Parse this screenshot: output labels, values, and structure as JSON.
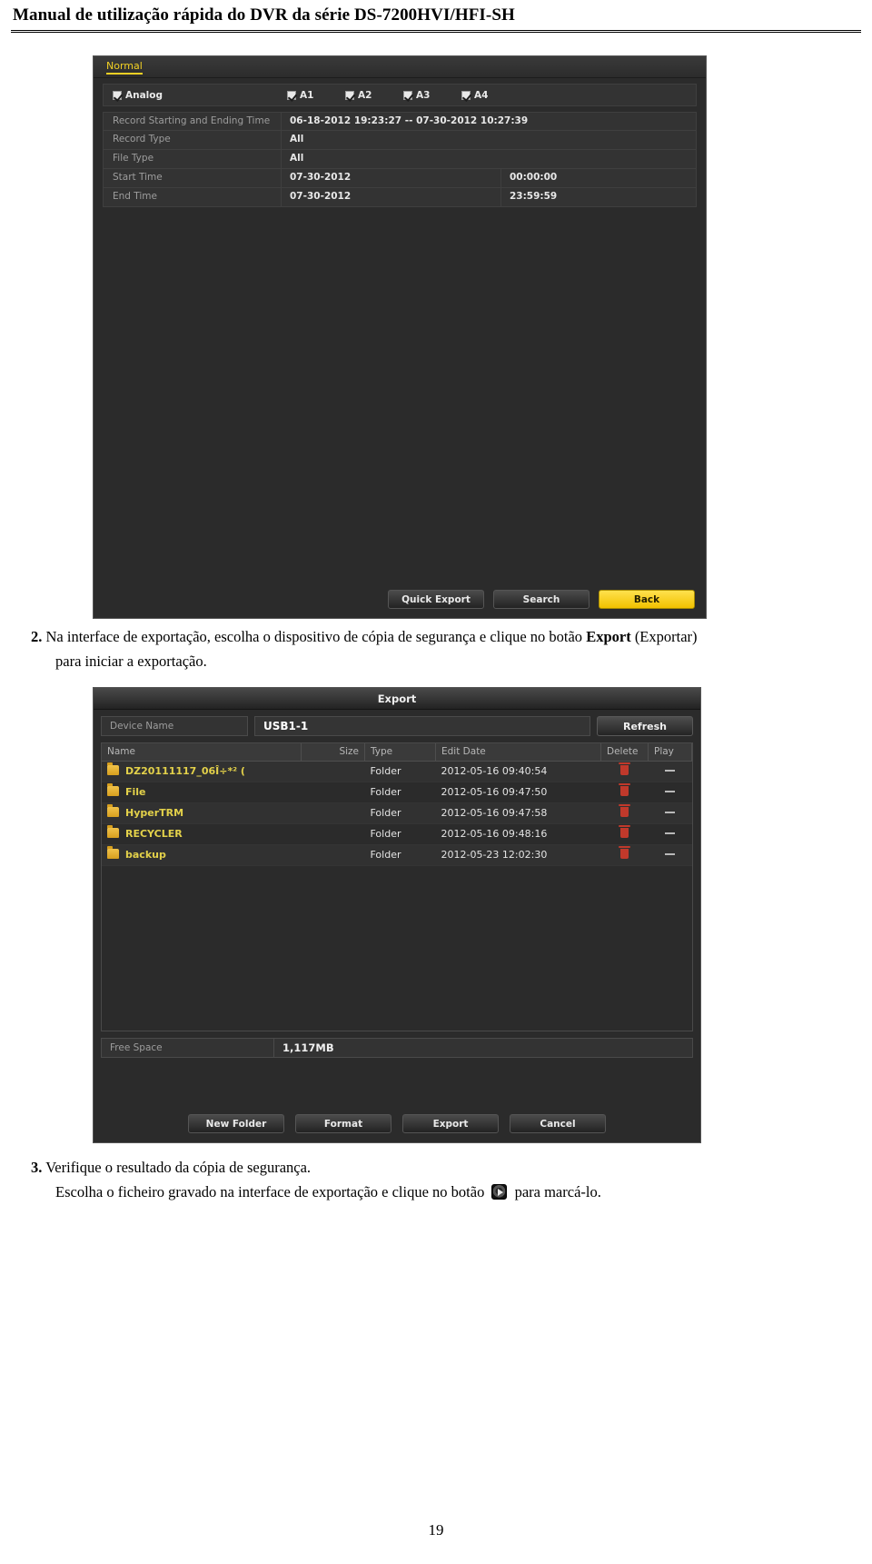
{
  "header": {
    "title": "Manual de utilização rápida do DVR da série DS-7200HVI/HFI-SH"
  },
  "search_panel": {
    "tab_label": "Normal",
    "analog": {
      "label": "Analog",
      "channels": [
        "A1",
        "A2",
        "A3",
        "A4"
      ]
    },
    "rows": [
      {
        "label": "Record Starting and Ending Time",
        "value": "06-18-2012 19:23:27   --   07-30-2012 10:27:39"
      },
      {
        "label": "Record Type",
        "value": "All"
      },
      {
        "label": "File Type",
        "value": "All"
      }
    ],
    "start_time": {
      "label": "Start Time",
      "date": "07-30-2012",
      "time": "00:00:00"
    },
    "end_time": {
      "label": "End Time",
      "date": "07-30-2012",
      "time": "23:59:59"
    },
    "buttons": {
      "quick_export": "Quick Export",
      "search": "Search",
      "back": "Back"
    },
    "accent_color": "#f2c200"
  },
  "instruction_2": {
    "number": "2.",
    "line1_a": "Na interface de exportação, escolha o dispositivo de cópia de segurança e clique no botão ",
    "line1_bold": "Export",
    "line1_b": " (Exportar)",
    "line2": "para iniciar a exportação."
  },
  "export_dialog": {
    "title": "Export",
    "device": {
      "label": "Device Name",
      "value": "USB1-1",
      "refresh_label": "Refresh"
    },
    "columns": [
      "Name",
      "Size",
      "Type",
      "Edit Date",
      "Delete",
      "Play"
    ],
    "files": [
      {
        "name": "DZ20111117_06Î÷*² (",
        "size": "",
        "type": "Folder",
        "date": "2012-05-16 09:40:54",
        "delete": "trash-icon",
        "play": "dash-icon"
      },
      {
        "name": "File",
        "size": "",
        "type": "Folder",
        "date": "2012-05-16 09:47:50",
        "delete": "trash-icon",
        "play": "dash-icon"
      },
      {
        "name": "HyperTRM",
        "size": "",
        "type": "Folder",
        "date": "2012-05-16 09:47:58",
        "delete": "trash-icon",
        "play": "dash-icon"
      },
      {
        "name": "RECYCLER",
        "size": "",
        "type": "Folder",
        "date": "2012-05-16 09:48:16",
        "delete": "trash-icon",
        "play": "dash-icon"
      },
      {
        "name": "backup",
        "size": "",
        "type": "Folder",
        "date": "2012-05-23 12:02:30",
        "delete": "trash-icon",
        "play": "dash-icon"
      }
    ],
    "free_space": {
      "label": "Free Space",
      "value": "1,117MB"
    },
    "buttons": {
      "new_folder": "New Folder",
      "format": "Format",
      "export": "Export",
      "cancel": "Cancel"
    }
  },
  "instruction_3": {
    "number": "3.",
    "line1": "Verifique o resultado da cópia de segurança.",
    "line2_a": "Escolha o ficheiro gravado na interface de exportação e clique no botão ",
    "line2_b": " para marcá-lo.",
    "icon": "play-icon"
  },
  "footer": {
    "page_number": "19"
  }
}
